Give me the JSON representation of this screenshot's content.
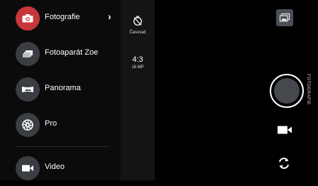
{
  "menu": {
    "items": [
      {
        "label": "Fotografie",
        "icon": "camera-icon",
        "color": "#c8353b",
        "active": true
      },
      {
        "label": "Fotoaparát Zoe",
        "icon": "zoe-icon",
        "color": "#3a3d42"
      },
      {
        "label": "Panorama",
        "icon": "panorama-icon",
        "color": "#3a3d42"
      },
      {
        "label": "Pro",
        "icon": "aperture-icon",
        "color": "#3a3d42"
      },
      {
        "label": "Video",
        "icon": "video-icon",
        "color": "#3a3d42"
      }
    ],
    "expand_glyph": "›"
  },
  "options": {
    "timer_label": "Časovač",
    "aspect_ratio": "4:3",
    "resolution": "16 MP"
  },
  "mode_label": "FOTOGRAFIE"
}
